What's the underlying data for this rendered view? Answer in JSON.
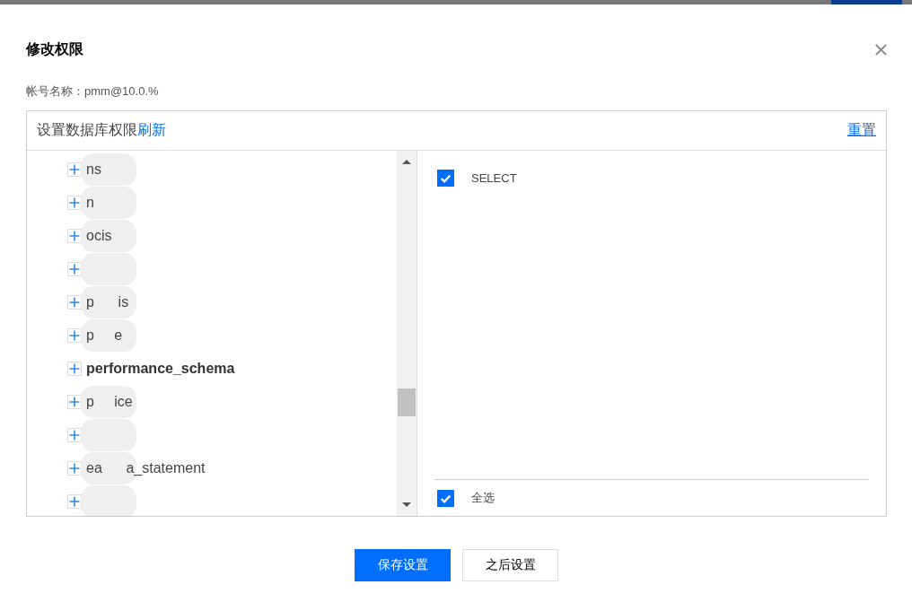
{
  "dialog": {
    "title": "修改权限",
    "account": "帐号名称：pmm@10.0.%"
  },
  "panel": {
    "heading": "设置数据库权限",
    "refresh": "刷新",
    "reset": "重置",
    "tree": [
      {
        "label": "ns",
        "masked": true,
        "selected": false
      },
      {
        "label": "n",
        "masked": true,
        "selected": false
      },
      {
        "label": "ocis",
        "masked": true,
        "selected": false
      },
      {
        "masked": true
      },
      {
        "label": "p      is",
        "masked": true,
        "selected": false
      },
      {
        "label": "p     e",
        "masked": true,
        "selected": false
      },
      {
        "label": "performance_schema",
        "masked": false,
        "selected": true
      },
      {
        "label": "p     ice",
        "masked": true,
        "selected": false
      },
      {
        "masked": true
      },
      {
        "label": "ea      a_statement",
        "masked": true,
        "selected": false
      },
      {
        "masked": true
      }
    ],
    "privileges": [
      {
        "label": "SELECT",
        "checked": true
      }
    ],
    "select_all": {
      "label": "全选",
      "checked": true
    }
  },
  "buttons": [
    {
      "label": "保存设置",
      "kind": "primary"
    },
    {
      "label": "之后设置",
      "kind": "secondary"
    }
  ]
}
